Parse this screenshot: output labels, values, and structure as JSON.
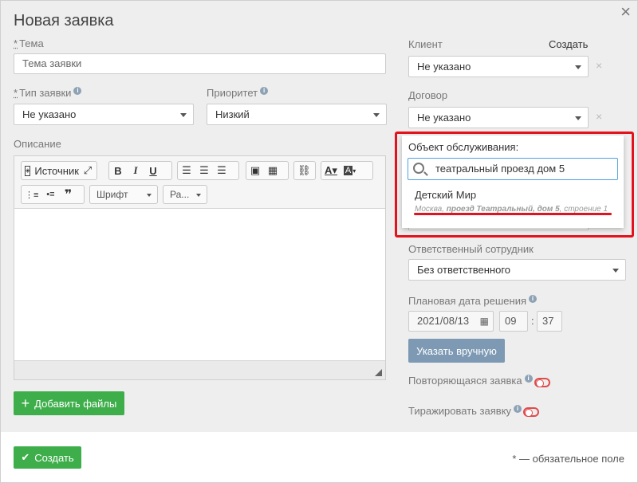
{
  "dialog": {
    "title": "Новая заявка",
    "close": "×"
  },
  "form": {
    "topic": {
      "label": "Тема",
      "placeholder": "Тема заявки"
    },
    "type": {
      "label": "Тип заявки",
      "value": "Не указано"
    },
    "priority": {
      "label": "Приоритет",
      "value": "Низкий"
    },
    "description": {
      "label": "Описание"
    },
    "client": {
      "label": "Клиент",
      "create_link": "Создать",
      "value": "Не указано"
    },
    "contract": {
      "label": "Договор",
      "value": "Не указано"
    },
    "service_object": {
      "label": "Объект обслуживания:",
      "search_value": "театральный проезд дом 5",
      "result_name": "Детский Мир",
      "result_addr_city": "Москва, ",
      "result_addr_bold": "проезд Театральный, дом 5",
      "result_addr_rest": ", строение 1"
    },
    "responsible": {
      "label": "Ответственный сотрудник",
      "value": "Без ответственного"
    },
    "due_date": {
      "label": "Плановая дата решения",
      "date": "2021/08/13",
      "hour": "09",
      "sep": ":",
      "minute": "37",
      "manual_button": "Указать вручную"
    },
    "recurring": {
      "label": "Повторяющаяся заявка"
    },
    "replicate": {
      "label": "Тиражировать заявку"
    },
    "add_files_button": "Добавить файлы"
  },
  "editor_toolbar": {
    "source": "Источник",
    "bold": "B",
    "italic": "I",
    "underline": "U",
    "quote": "❞",
    "font_combo": "Шрифт",
    "size_combo": "Ра..."
  },
  "footer": {
    "create_button": "Создать",
    "required_note": "* — обязательное поле"
  },
  "required_mark": "*",
  "info_mark": "i",
  "clear_mark": "×",
  "colors": {
    "accent_green": "#3eae4b",
    "button_blue": "#7d99b3",
    "highlight_red": "#e3121c",
    "search_border": "#4da3e0"
  }
}
